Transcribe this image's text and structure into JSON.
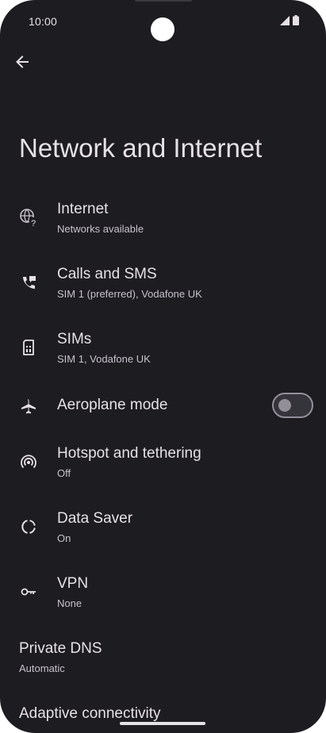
{
  "status_bar": {
    "time": "10:00",
    "icons": [
      "signal-icon",
      "battery-icon"
    ]
  },
  "header": {
    "back_icon": "arrow-back-icon",
    "title": "Network and Internet"
  },
  "items": [
    {
      "icon": "globe-question-icon",
      "title": "Internet",
      "subtitle": "Networks available"
    },
    {
      "icon": "phone-sms-icon",
      "title": "Calls and SMS",
      "subtitle": "SIM 1 (preferred), Vodafone UK"
    },
    {
      "icon": "sim-card-icon",
      "title": "SIMs",
      "subtitle": "SIM 1, Vodafone UK"
    },
    {
      "icon": "airplane-icon",
      "title": "Aeroplane mode",
      "toggle_on": false
    },
    {
      "icon": "hotspot-icon",
      "title": "Hotspot and tethering",
      "subtitle": "Off"
    },
    {
      "icon": "data-saver-icon",
      "title": "Data Saver",
      "subtitle": "On"
    },
    {
      "icon": "vpn-key-icon",
      "title": "VPN",
      "subtitle": "None"
    },
    {
      "title": "Private DNS",
      "subtitle": "Automatic"
    },
    {
      "title": "Adaptive connectivity"
    }
  ],
  "colors": {
    "background": "#1d1c21",
    "text_primary": "#e6e1e5",
    "text_secondary": "#c7c3cb",
    "toggle_outline": "#938f99"
  }
}
